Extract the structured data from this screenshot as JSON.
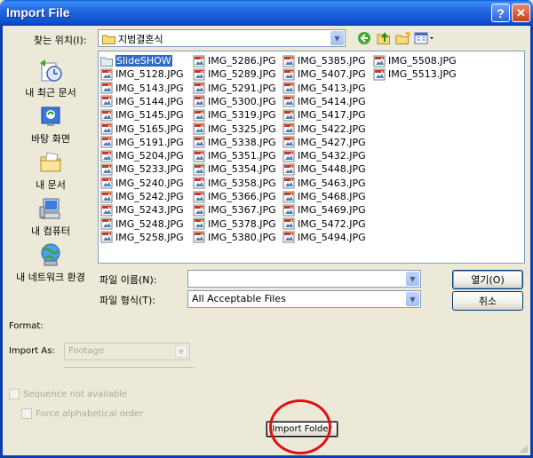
{
  "window": {
    "title": "Import File"
  },
  "toolbar": {
    "look_in_label": "찾는 위치(I):",
    "current_folder": "지범결혼식"
  },
  "places": [
    {
      "label": "내 최근 문서",
      "icon": "recent-documents-icon"
    },
    {
      "label": "바탕 화면",
      "icon": "desktop-icon"
    },
    {
      "label": "내 문서",
      "icon": "my-documents-icon"
    },
    {
      "label": "내 컴퓨터",
      "icon": "my-computer-icon"
    },
    {
      "label": "내 네트워크 환경",
      "icon": "my-network-icon"
    }
  ],
  "files": {
    "folder": "SlideSHOW",
    "col1": [
      "IMG_5128.JPG",
      "IMG_5143.JPG",
      "IMG_5144.JPG",
      "IMG_5145.JPG",
      "IMG_5165.JPG",
      "IMG_5191.JPG",
      "IMG_5204.JPG",
      "IMG_5233.JPG",
      "IMG_5240.JPG",
      "IMG_5242.JPG",
      "IMG_5243.JPG",
      "IMG_5248.JPG",
      "IMG_5258.JPG"
    ],
    "col2": [
      "IMG_5286.JPG",
      "IMG_5289.JPG",
      "IMG_5291.JPG",
      "IMG_5300.JPG",
      "IMG_5319.JPG",
      "IMG_5325.JPG",
      "IMG_5338.JPG",
      "IMG_5351.JPG",
      "IMG_5354.JPG",
      "IMG_5358.JPG",
      "IMG_5366.JPG",
      "IMG_5367.JPG",
      "IMG_5378.JPG",
      "IMG_5380.JPG"
    ],
    "col3": [
      "IMG_5385.JPG",
      "IMG_5407.JPG",
      "IMG_5413.JPG",
      "IMG_5414.JPG",
      "IMG_5417.JPG",
      "IMG_5422.JPG",
      "IMG_5427.JPG",
      "IMG_5432.JPG",
      "IMG_5448.JPG",
      "IMG_5463.JPG",
      "IMG_5468.JPG",
      "IMG_5469.JPG",
      "IMG_5472.JPG",
      "IMG_5494.JPG"
    ],
    "col4": [
      "IMG_5508.JPG",
      "IMG_5513.JPG"
    ]
  },
  "filename": {
    "label": "파일 이름(N):",
    "value": ""
  },
  "filetype": {
    "label": "파일 형식(T):",
    "value": "All Acceptable Files"
  },
  "buttons": {
    "open": "열기(O)",
    "cancel": "취소",
    "import_folder": "Import Folder"
  },
  "import_options": {
    "format_label": "Format:",
    "import_as_label": "Import As:",
    "import_as_value": "Footage",
    "sequence_label": "Sequence not available",
    "force_alpha_label": "Force alphabetical order"
  },
  "colors": {
    "selection": "#316AC5",
    "highlight_circle": "#E01010",
    "titlebar": "#0A5FD8"
  }
}
